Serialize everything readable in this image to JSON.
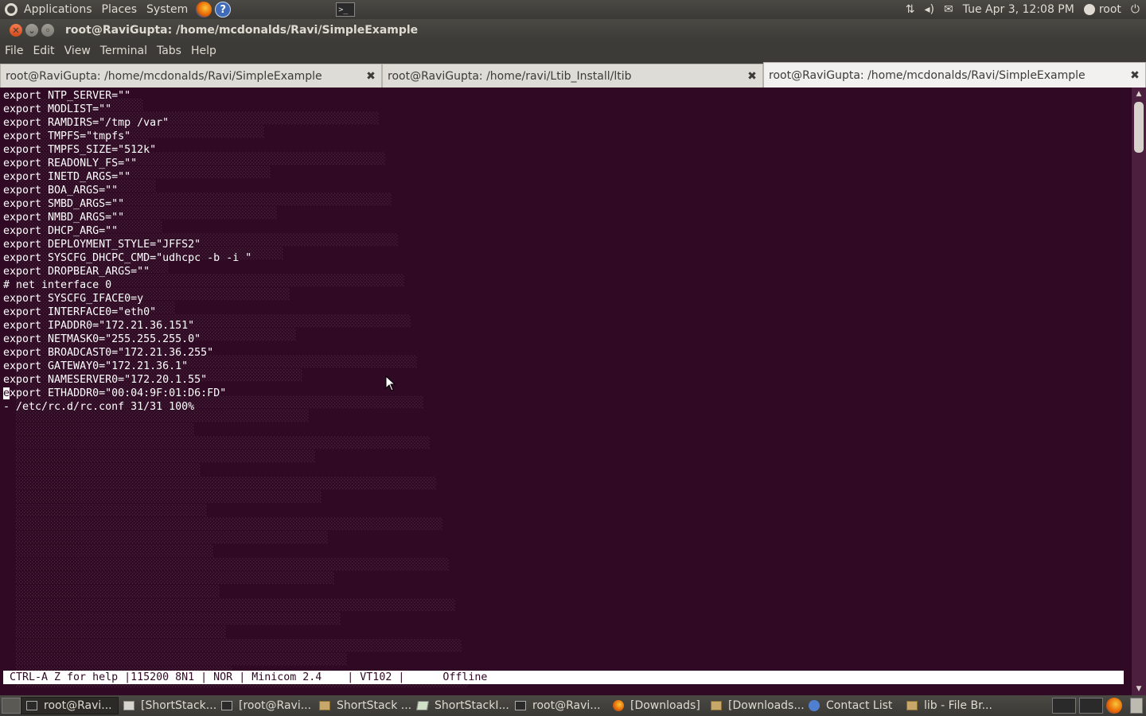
{
  "top_panel": {
    "menus": [
      "Applications",
      "Places",
      "System"
    ],
    "clock": "Tue Apr  3, 12:08 PM",
    "user": "root"
  },
  "window": {
    "title": "root@RaviGupta: /home/mcdonalds/Ravi/SimpleExample",
    "menu": [
      "File",
      "Edit",
      "View",
      "Terminal",
      "Tabs",
      "Help"
    ]
  },
  "tabs": [
    {
      "label": "root@RaviGupta: /home/mcdonalds/Ravi/SimpleExample",
      "active": false
    },
    {
      "label": "root@RaviGupta: /home/ravi/Ltib_Install/ltib",
      "active": false
    },
    {
      "label": "root@RaviGupta: /home/mcdonalds/Ravi/SimpleExample",
      "active": true
    }
  ],
  "terminal": {
    "lines": [
      "export NTP_SERVER=\"\"",
      "export MODLIST=\"\"",
      "export RAMDIRS=\"/tmp /var\"",
      "export TMPFS=\"tmpfs\"",
      "export TMPFS_SIZE=\"512k\"",
      "export READONLY_FS=\"\"",
      "export INETD_ARGS=\"\"",
      "export BOA_ARGS=\"\"",
      "export SMBD_ARGS=\"\"",
      "export NMBD_ARGS=\"\"",
      "export DHCP_ARG=\"\"",
      "export DEPLOYMENT_STYLE=\"JFFS2\"",
      "export SYSCFG_DHCPC_CMD=\"udhcpc -b -i \"",
      "export DROPBEAR_ARGS=\"\"",
      "# net interface 0",
      "export SYSCFG_IFACE0=y",
      "export INTERFACE0=\"eth0\"",
      "export IPADDR0=\"172.21.36.151\"",
      "export NETMASK0=\"255.255.255.0\"",
      "export BROADCAST0=\"172.21.36.255\"",
      "export GATEWAY0=\"172.21.36.1\"",
      "export NAMESERVER0=\"172.20.1.55\""
    ],
    "cursor_line_first_char": "e",
    "cursor_line_rest": "xport ETHADDR0=\"00:04:9F:01:D6:FD\"",
    "pager_line": "- /etc/rc.d/rc.conf 31/31 100%",
    "status_line": "CTRL-A Z for help |115200 8N1 | NOR | Minicom 2.4    | VT102 |      Offline"
  },
  "taskbar": {
    "tasks": [
      {
        "label": "root@Ravi...",
        "icon": "terminal-icon",
        "active": true
      },
      {
        "label": "[ShortStack...",
        "icon": "document-icon",
        "active": false
      },
      {
        "label": "[root@Ravi...",
        "icon": "terminal-icon",
        "active": false
      },
      {
        "label": "ShortStack ...",
        "icon": "folder-icon",
        "active": false
      },
      {
        "label": "ShortStackI...",
        "icon": "text-editor-icon",
        "active": false
      },
      {
        "label": "root@Ravi...",
        "icon": "terminal-icon",
        "active": false
      },
      {
        "label": "[Downloads]",
        "icon": "firefox-icon",
        "active": false
      },
      {
        "label": "[Downloads...",
        "icon": "folder-icon",
        "active": false
      },
      {
        "label": "Contact List",
        "icon": "chat-icon",
        "active": false
      },
      {
        "label": "lib - File Br...",
        "icon": "folder-icon",
        "active": false
      }
    ]
  },
  "colors": {
    "terminal_bg": "#300a24",
    "panel_bg": "#3c3b37",
    "close_button": "#e05a28"
  }
}
